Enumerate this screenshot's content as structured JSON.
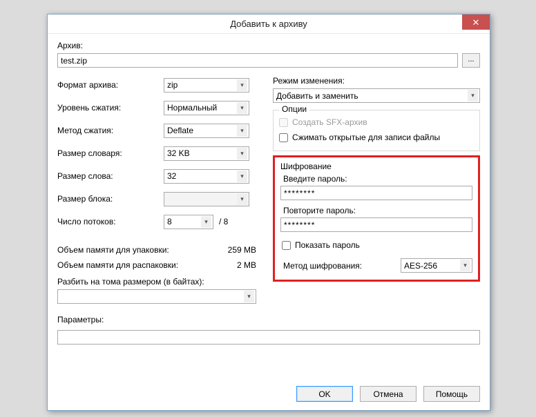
{
  "window": {
    "title": "Добавить к архиву",
    "close_glyph": "✕"
  },
  "archive": {
    "label": "Архив:",
    "value": "test.zip",
    "browse_glyph": "..."
  },
  "left": {
    "format_label": "Формат архива:",
    "format_value": "zip",
    "level_label": "Уровень сжатия:",
    "level_value": "Нормальный",
    "method_label": "Метод сжатия:",
    "method_value": "Deflate",
    "dict_label": "Размер словаря:",
    "dict_value": "32 KB",
    "word_label": "Размер слова:",
    "word_value": "32",
    "block_label": "Размер блока:",
    "block_value": "",
    "threads_label": "Число потоков:",
    "threads_value": "8",
    "threads_max": "/ 8",
    "mem_pack_label": "Объем памяти для упаковки:",
    "mem_pack_value": "259 MB",
    "mem_unpack_label": "Объем памяти для распаковки:",
    "mem_unpack_value": "2 MB",
    "split_label": "Разбить на тома размером (в байтах):",
    "split_value": ""
  },
  "right": {
    "update_label": "Режим изменения:",
    "update_value": "Добавить и заменить",
    "options_legend": "Опции",
    "sfx_label": "Создать SFX-архив",
    "shared_label": "Сжимать открытые для записи файлы",
    "enc_legend": "Шифрование",
    "pw_label": "Введите пароль:",
    "pw_value": "********",
    "pw2_label": "Повторите пароль:",
    "pw2_value": "********",
    "showpw_label": "Показать пароль",
    "encmethod_label": "Метод шифрования:",
    "encmethod_value": "AES-256"
  },
  "params": {
    "label": "Параметры:",
    "value": ""
  },
  "buttons": {
    "ok": "OK",
    "cancel": "Отмена",
    "help": "Помощь"
  }
}
